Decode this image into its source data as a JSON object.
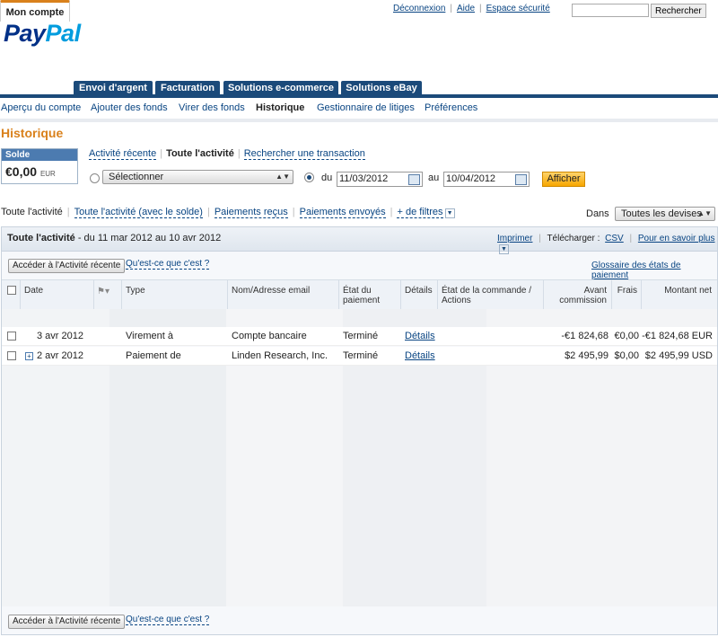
{
  "header": {
    "logout": "Déconnexion",
    "help": "Aide",
    "security": "Espace sécurité",
    "search_button": "Rechercher",
    "logo_a": "Pay",
    "logo_b": "Pal"
  },
  "tabs": [
    "Mon compte",
    "Envoi d'argent",
    "Facturation",
    "Solutions e-commerce",
    "Solutions eBay"
  ],
  "subnav": [
    "Aperçu du compte",
    "Ajouter des fonds",
    "Virer des fonds",
    "Historique",
    "Gestionnaire de litiges",
    "Préférences"
  ],
  "page_title": "Historique",
  "balance": {
    "label": "Solde",
    "amount": "€0,00",
    "currency": "EUR"
  },
  "view_tabs": {
    "recent": "Activité récente",
    "all": "Toute l'activité",
    "search": "Rechercher une transaction"
  },
  "filter_form": {
    "select_value": "Sélectionner",
    "from_label": "du",
    "from_date": "11/03/2012",
    "to_label": "au",
    "to_date": "10/04/2012",
    "submit": "Afficher"
  },
  "activity_filters": {
    "all": "Toute l'activité",
    "all_balance": "Toute l'activité (avec le solde)",
    "received": "Paiements reçus",
    "sent": "Paiements envoyés",
    "more": "+ de filtres"
  },
  "currency": {
    "label": "Dans",
    "value": "Toutes les devises"
  },
  "panel": {
    "title_bold": "Toute l'activité",
    "title_range": " - du 11 mar 2012 au 10 avr 2012",
    "print": "Imprimer",
    "download_label": "Télécharger :",
    "csv": "CSV",
    "learn_more": "Pour en savoir plus",
    "back_button": "Accéder à l'Activité récente",
    "what_is": "Qu'est-ce que c'est ?",
    "glossary": "Glossaire des états de paiement"
  },
  "columns": {
    "date": "Date",
    "type": "Type",
    "name": "Nom/Adresse email",
    "status_1": "État du",
    "status_2": "paiement",
    "details": "Détails",
    "order_1": "État de la commande /",
    "order_2": "Actions",
    "gross_1": "Avant",
    "gross_2": "commission",
    "fees": "Frais",
    "net": "Montant net"
  },
  "rows": [
    {
      "date": "3 avr 2012",
      "type": "Virement à",
      "name": "Compte bancaire",
      "status": "Terminé",
      "details": "Détails",
      "gross": "-€1 824,68",
      "fee": "€0,00",
      "net": "-€1 824,68 EUR"
    },
    {
      "date": "2 avr 2012",
      "type": "Paiement de",
      "name": "Linden Research, Inc.",
      "status": "Terminé",
      "details": "Détails",
      "gross": "$2 495,99",
      "fee": "$0,00",
      "net": "$2 495,99 USD"
    }
  ]
}
